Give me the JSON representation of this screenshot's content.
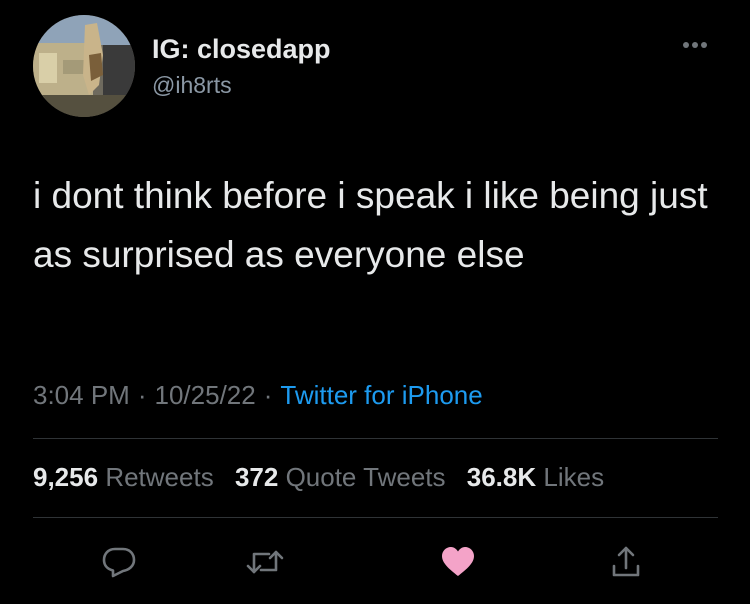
{
  "author": {
    "display_name": "IG: closedapp",
    "handle": "@ih8rts"
  },
  "tweet": {
    "text": "i dont think before i speak i like being just as surprised as everyone else",
    "time": "3:04 PM",
    "date": "10/25/22",
    "separator": "·",
    "source": "Twitter for iPhone"
  },
  "stats": {
    "retweets_count": "9,256",
    "retweets_label": "Retweets",
    "quotes_count": "372",
    "quotes_label": "Quote Tweets",
    "likes_count": "36.8K",
    "likes_label": "Likes"
  },
  "icons": {
    "more": "more-options-icon",
    "reply": "reply-icon",
    "retweet": "retweet-icon",
    "like": "heart-icon",
    "share": "share-icon"
  },
  "colors": {
    "background": "#000000",
    "text": "#e7e9ea",
    "secondary_text": "#71767b",
    "link": "#1d9bf0",
    "like_active": "#f91880"
  }
}
